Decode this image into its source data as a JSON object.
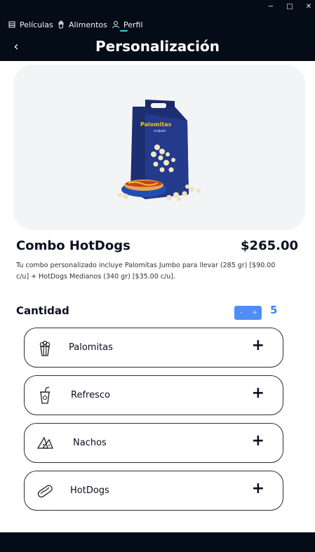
{
  "window": {
    "minimize": "−",
    "maximize": "□",
    "close": "✕"
  },
  "nav": {
    "items": [
      {
        "label": "Películas",
        "icon": "film-icon"
      },
      {
        "label": "Alimentos",
        "icon": "popcorn-icon"
      },
      {
        "label": "Perfil",
        "icon": "user-icon"
      }
    ],
    "active": "Perfil"
  },
  "header": {
    "back": "‹",
    "title": "Personalización"
  },
  "product": {
    "name": "Combo HotDogs",
    "price": "$265.00",
    "description": "Tu combo personalizado incluye Palomitas Jumbo para llevar (285 gr) [$90.00 c/u] + HotDogs Medianos (340 gr) [$35.00 c/u].",
    "box_brand": "Palomitas",
    "box_sub": "cinépolis"
  },
  "quantity": {
    "label": "Cantidad",
    "minus": "-",
    "plus": "+",
    "value": "5"
  },
  "extras": [
    {
      "label": "Palomitas",
      "icon": "popcorn-icon",
      "action": "+"
    },
    {
      "label": "Refresco",
      "icon": "drink-cup-icon",
      "action": "+"
    },
    {
      "label": "Nachos",
      "icon": "nachos-icon",
      "action": "+"
    },
    {
      "label": "HotDogs",
      "icon": "hotdog-icon",
      "action": "+"
    }
  ],
  "colors": {
    "dark": "#040c18",
    "accent": "#35c9e0",
    "blue": "#3b82f6"
  }
}
